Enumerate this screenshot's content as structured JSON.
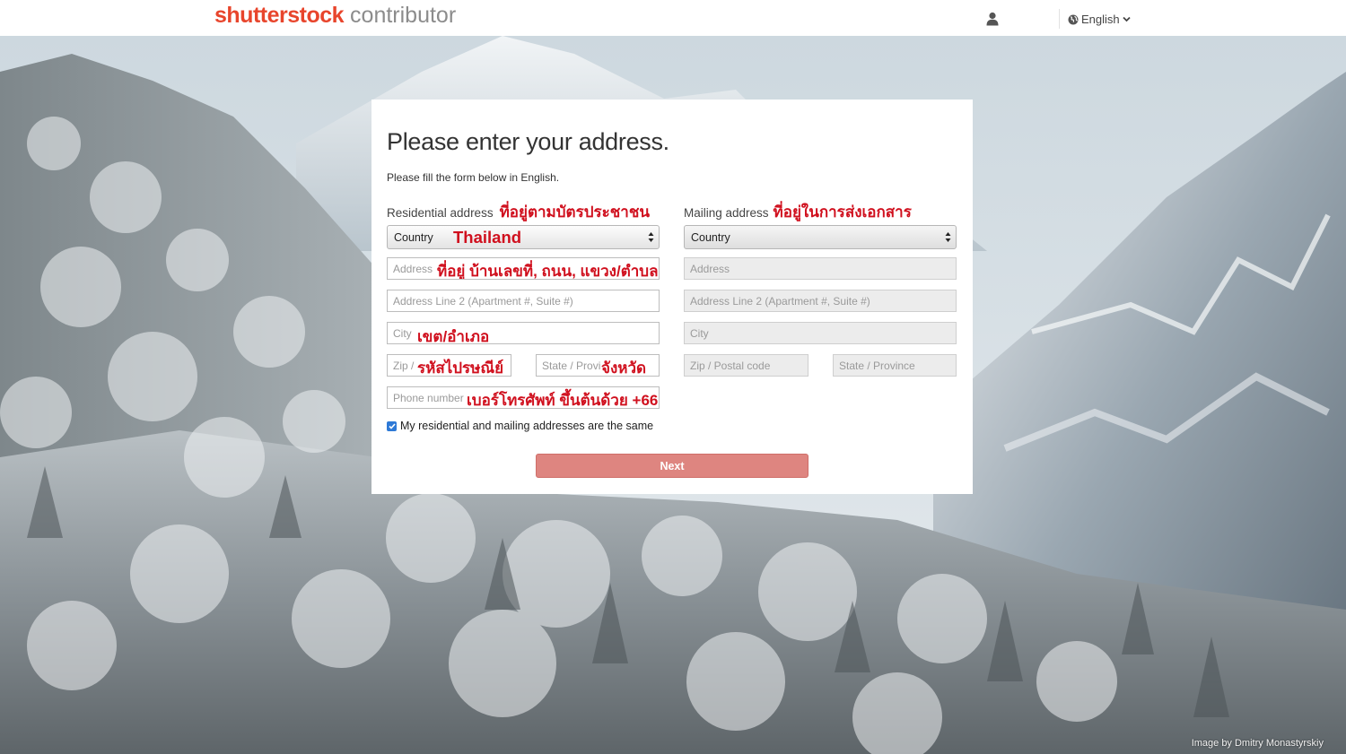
{
  "header": {
    "brand": "shutterstock",
    "product": "contributor",
    "language": "English"
  },
  "form": {
    "title": "Please enter your address.",
    "subtitle": "Please fill the form below in English.",
    "residential": {
      "heading": "Residential address",
      "heading_thai": "ที่อยู่ตามบัตรประชาชน",
      "country_label": "Country",
      "country_value": "Thailand",
      "address_placeholder": "Address",
      "address_thai": "ที่อยู่ บ้านเลขที่, ถนน, แขวง/ตำบล",
      "address2_placeholder": "Address Line 2 (Apartment #, Suite #)",
      "city_placeholder": "City",
      "city_thai": "เขต/อำเภอ",
      "zip_placeholder": "Zip / Postal code",
      "zip_thai": "รหัสไปรษณีย์",
      "state_placeholder": "State / Province",
      "state_thai": "จังหวัด",
      "phone_placeholder": "Phone number",
      "phone_thai": "เบอร์โทรศัพท์ ขึ้นต้นด้วย +66"
    },
    "mailing": {
      "heading": "Mailing address",
      "heading_thai": "ที่อยู่ในการส่งเอกสาร",
      "country_label": "Country",
      "address_placeholder": "Address",
      "address2_placeholder": "Address Line 2 (Apartment #, Suite #)",
      "city_placeholder": "City",
      "zip_placeholder": "Zip / Postal code",
      "state_placeholder": "State / Province"
    },
    "same_address_label": "My residential and mailing addresses are the same",
    "same_address_checked": true,
    "next_label": "Next"
  },
  "background": {
    "credit": "Image by Dmitry Monastyrskiy"
  },
  "colors": {
    "brand_red": "#e8452c",
    "annotation_red": "#d0101e",
    "next_button": "#de8580",
    "checkbox_blue": "#2e79d6"
  },
  "icons": {
    "user": "user-icon",
    "language": "globe-icon",
    "language_caret": "chevron-down-icon",
    "select_arrows": "select-arrows-icon",
    "checkbox": "checkmark-icon"
  }
}
